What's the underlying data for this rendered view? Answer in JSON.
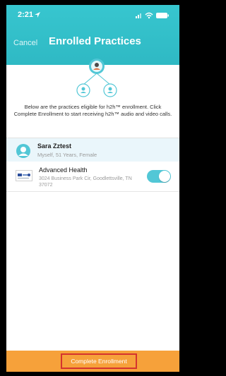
{
  "status_bar": {
    "time": "2:21",
    "location_icon": "location-arrow-icon",
    "signal_icon": "cellular-signal-icon",
    "wifi_icon": "wifi-icon",
    "battery_icon": "battery-icon"
  },
  "header": {
    "cancel_label": "Cancel",
    "title": "Enrolled Practices",
    "background": "#33bfca"
  },
  "description": "Below are the practices eligible for h2h™ enrollment. Click Complete Enrollment to start receiving h2h™ audio and video calls.",
  "patient": {
    "name": "Sara Zztest",
    "info": "Myself, 51 Years, Female"
  },
  "practices": [
    {
      "name": "Advanced Health",
      "address": "3024 Business Park Cir, Goodlettsville, TN 37072",
      "enabled": true
    }
  ],
  "footer": {
    "button_label": "Complete Enrollment",
    "background": "#f6a13a",
    "highlight": "#d5332f"
  },
  "colors": {
    "accent": "#52c7d6"
  }
}
